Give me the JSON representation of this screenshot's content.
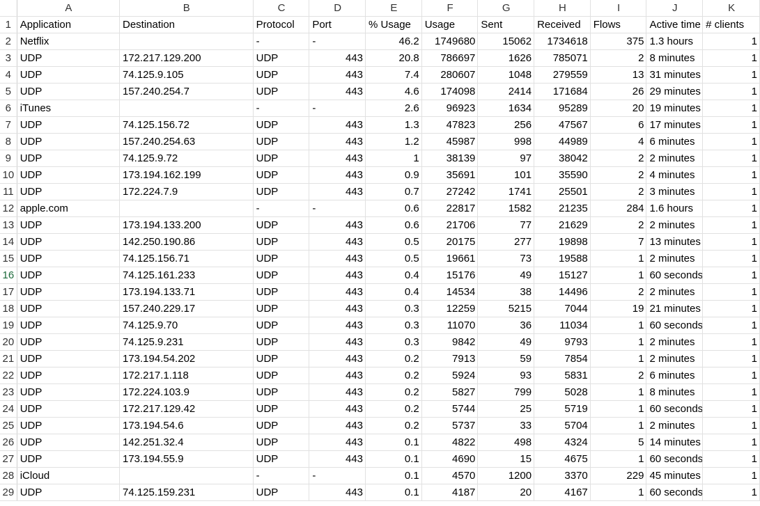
{
  "sheet": {
    "columns": [
      "A",
      "B",
      "C",
      "D",
      "E",
      "F",
      "G",
      "H",
      "I",
      "J",
      "K"
    ],
    "active_row": 16,
    "rows": [
      [
        "Application",
        "Destination",
        "Protocol",
        "Port",
        "% Usage",
        "Usage",
        "Sent",
        "Received",
        "Flows",
        "Active time",
        "# clients"
      ],
      [
        "Netflix",
        "",
        "-",
        "-",
        "46.2",
        "1749680",
        "15062",
        "1734618",
        "375",
        "1.3 hours",
        "1"
      ],
      [
        "UDP",
        "172.217.129.200",
        "UDP",
        "443",
        "20.8",
        "786697",
        "1626",
        "785071",
        "2",
        "8 minutes",
        "1"
      ],
      [
        "UDP",
        "74.125.9.105",
        "UDP",
        "443",
        "7.4",
        "280607",
        "1048",
        "279559",
        "13",
        "31 minutes",
        "1"
      ],
      [
        "UDP",
        "157.240.254.7",
        "UDP",
        "443",
        "4.6",
        "174098",
        "2414",
        "171684",
        "26",
        "29 minutes",
        "1"
      ],
      [
        "iTunes",
        "",
        "-",
        "-",
        "2.6",
        "96923",
        "1634",
        "95289",
        "20",
        "19 minutes",
        "1"
      ],
      [
        "UDP",
        "74.125.156.72",
        "UDP",
        "443",
        "1.3",
        "47823",
        "256",
        "47567",
        "6",
        "17 minutes",
        "1"
      ],
      [
        "UDP",
        "157.240.254.63",
        "UDP",
        "443",
        "1.2",
        "45987",
        "998",
        "44989",
        "4",
        "6 minutes",
        "1"
      ],
      [
        "UDP",
        "74.125.9.72",
        "UDP",
        "443",
        "1",
        "38139",
        "97",
        "38042",
        "2",
        "2 minutes",
        "1"
      ],
      [
        "UDP",
        "173.194.162.199",
        "UDP",
        "443",
        "0.9",
        "35691",
        "101",
        "35590",
        "2",
        "4 minutes",
        "1"
      ],
      [
        "UDP",
        "172.224.7.9",
        "UDP",
        "443",
        "0.7",
        "27242",
        "1741",
        "25501",
        "2",
        "3 minutes",
        "1"
      ],
      [
        "apple.com",
        "",
        "-",
        "-",
        "0.6",
        "22817",
        "1582",
        "21235",
        "284",
        "1.6 hours",
        "1"
      ],
      [
        "UDP",
        "173.194.133.200",
        "UDP",
        "443",
        "0.6",
        "21706",
        "77",
        "21629",
        "2",
        "2 minutes",
        "1"
      ],
      [
        "UDP",
        "142.250.190.86",
        "UDP",
        "443",
        "0.5",
        "20175",
        "277",
        "19898",
        "7",
        "13 minutes",
        "1"
      ],
      [
        "UDP",
        "74.125.156.71",
        "UDP",
        "443",
        "0.5",
        "19661",
        "73",
        "19588",
        "1",
        "2 minutes",
        "1"
      ],
      [
        "UDP",
        "74.125.161.233",
        "UDP",
        "443",
        "0.4",
        "15176",
        "49",
        "15127",
        "1",
        "60 seconds",
        "1"
      ],
      [
        "UDP",
        "173.194.133.71",
        "UDP",
        "443",
        "0.4",
        "14534",
        "38",
        "14496",
        "2",
        "2 minutes",
        "1"
      ],
      [
        "UDP",
        "157.240.229.17",
        "UDP",
        "443",
        "0.3",
        "12259",
        "5215",
        "7044",
        "19",
        "21 minutes",
        "1"
      ],
      [
        "UDP",
        "74.125.9.70",
        "UDP",
        "443",
        "0.3",
        "11070",
        "36",
        "11034",
        "1",
        "60 seconds",
        "1"
      ],
      [
        "UDP",
        "74.125.9.231",
        "UDP",
        "443",
        "0.3",
        "9842",
        "49",
        "9793",
        "1",
        "2 minutes",
        "1"
      ],
      [
        "UDP",
        "173.194.54.202",
        "UDP",
        "443",
        "0.2",
        "7913",
        "59",
        "7854",
        "1",
        "2 minutes",
        "1"
      ],
      [
        "UDP",
        "172.217.1.118",
        "UDP",
        "443",
        "0.2",
        "5924",
        "93",
        "5831",
        "2",
        "6 minutes",
        "1"
      ],
      [
        "UDP",
        "172.224.103.9",
        "UDP",
        "443",
        "0.2",
        "5827",
        "799",
        "5028",
        "1",
        "8 minutes",
        "1"
      ],
      [
        "UDP",
        "172.217.129.42",
        "UDP",
        "443",
        "0.2",
        "5744",
        "25",
        "5719",
        "1",
        "60 seconds",
        "1"
      ],
      [
        "UDP",
        "173.194.54.6",
        "UDP",
        "443",
        "0.2",
        "5737",
        "33",
        "5704",
        "1",
        "2 minutes",
        "1"
      ],
      [
        "UDP",
        "142.251.32.4",
        "UDP",
        "443",
        "0.1",
        "4822",
        "498",
        "4324",
        "5",
        "14 minutes",
        "1"
      ],
      [
        "UDP",
        "173.194.55.9",
        "UDP",
        "443",
        "0.1",
        "4690",
        "15",
        "4675",
        "1",
        "60 seconds",
        "1"
      ],
      [
        "iCloud",
        "",
        "-",
        "-",
        "0.1",
        "4570",
        "1200",
        "3370",
        "229",
        "45 minutes",
        "1"
      ],
      [
        "UDP",
        "74.125.159.231",
        "UDP",
        "443",
        "0.1",
        "4187",
        "20",
        "4167",
        "1",
        "60 seconds",
        "1"
      ]
    ]
  },
  "colors": {
    "gridline": "#e1e1e1",
    "header_border": "#cfcfcf",
    "active_row_number": "#1e6b3c"
  }
}
